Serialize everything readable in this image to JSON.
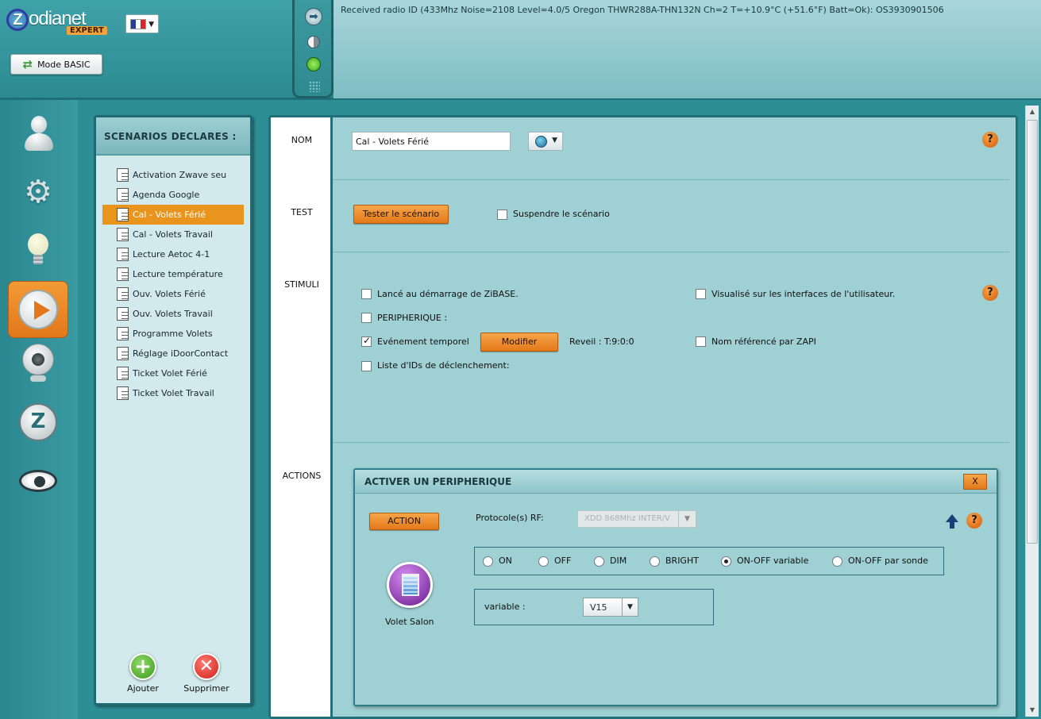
{
  "header": {
    "logo_text": "odianet",
    "logo_z": "Z",
    "logo_badge": "EXPERT",
    "language_flag": "fr",
    "mode_button": "Mode BASIC",
    "status_message": "Received radio ID (433Mhz Noise=2108 Level=4.0/5 Oregon  THWR288A-THN132N Ch=2 T=+10.9°C (+51.6°F)  Batt=Ok): OS3930901506"
  },
  "rail": {
    "items": [
      "user-icon",
      "gear-icon",
      "bulb-icon",
      "play-icon",
      "camera-icon",
      "zibase-icon",
      "eye-icon"
    ],
    "active": "play-icon"
  },
  "scenarios": {
    "title": "SCENARIOS DECLARES :",
    "items": [
      "Activation Zwave seu",
      "Agenda Google",
      "Cal - Volets Férié",
      "Cal - Volets Travail",
      "Lecture Aetoc 4-1",
      "Lecture température",
      "Ouv. Volets Férié",
      "Ouv. Volets Travail",
      "Programme Volets",
      "Réglage iDoorContact",
      "Ticket Volet Férié",
      "Ticket Volet Travail"
    ],
    "selected_index": 2,
    "add_label": "Ajouter",
    "delete_label": "Supprimer"
  },
  "sections": {
    "nom": "NOM",
    "test": "TEST",
    "stimuli": "STIMULI",
    "actions": "ACTIONS"
  },
  "nom": {
    "value": "Cal - Volets Férié"
  },
  "test": {
    "button": "Tester le scénario",
    "suspend_label": "Suspendre le scénario",
    "suspend_checked": false
  },
  "stimuli": {
    "start_label": "Lancé au démarrage de ZiBASE.",
    "peripherique_label": "PERIPHERIQUE :",
    "temporel_label": "Evénement temporel",
    "temporel_checked": true,
    "modify_button": "Modifier",
    "reveil_text": "Reveil : T:9:0:0",
    "ids_label": "Liste d'IDs de déclenchement:",
    "visual_label": "Visualisé sur les interfaces de l'utilisateur.",
    "zapi_label": "Nom référencé par ZAPI"
  },
  "action_panel": {
    "title": "ACTIVER UN PERIPHERIQUE",
    "close": "X",
    "action_button": "ACTION",
    "protocol_label": "Protocole(s) RF:",
    "protocol_value": "XDD 868Mhz INTER/V",
    "device_name": "Volet Salon",
    "options": [
      "ON",
      "OFF",
      "DIM",
      "BRIGHT",
      "ON-OFF variable",
      "ON-OFF par sonde"
    ],
    "selected_option": "ON-OFF variable",
    "variable_label": "variable :",
    "variable_value": "V15"
  },
  "help_glyph": "?",
  "colors": {
    "accent_orange": "#e9941d",
    "teal": "#2d8e96"
  }
}
